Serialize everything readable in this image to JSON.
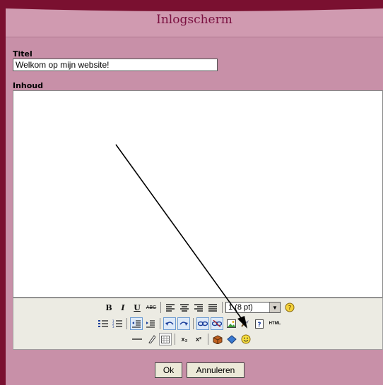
{
  "window": {
    "title": "Inlogscherm"
  },
  "form": {
    "titel_label": "Titel",
    "titel_value": "Welkom op mijn website!",
    "inhoud_label": "Inhoud"
  },
  "toolbar": {
    "row1": [
      "B",
      "I",
      "U",
      "ABC"
    ],
    "font_size": "1 (8 pt)",
    "html_label": "HTML",
    "subscript_label": "x₂",
    "superscript_label": "x²"
  },
  "footer": {
    "ok_label": "Ok",
    "cancel_label": "Annuleren"
  },
  "colors": {
    "frame": "#7a1030",
    "panel": "#c890a8",
    "title_text": "#7a1040",
    "toolbar_bg": "#ecebe3"
  }
}
